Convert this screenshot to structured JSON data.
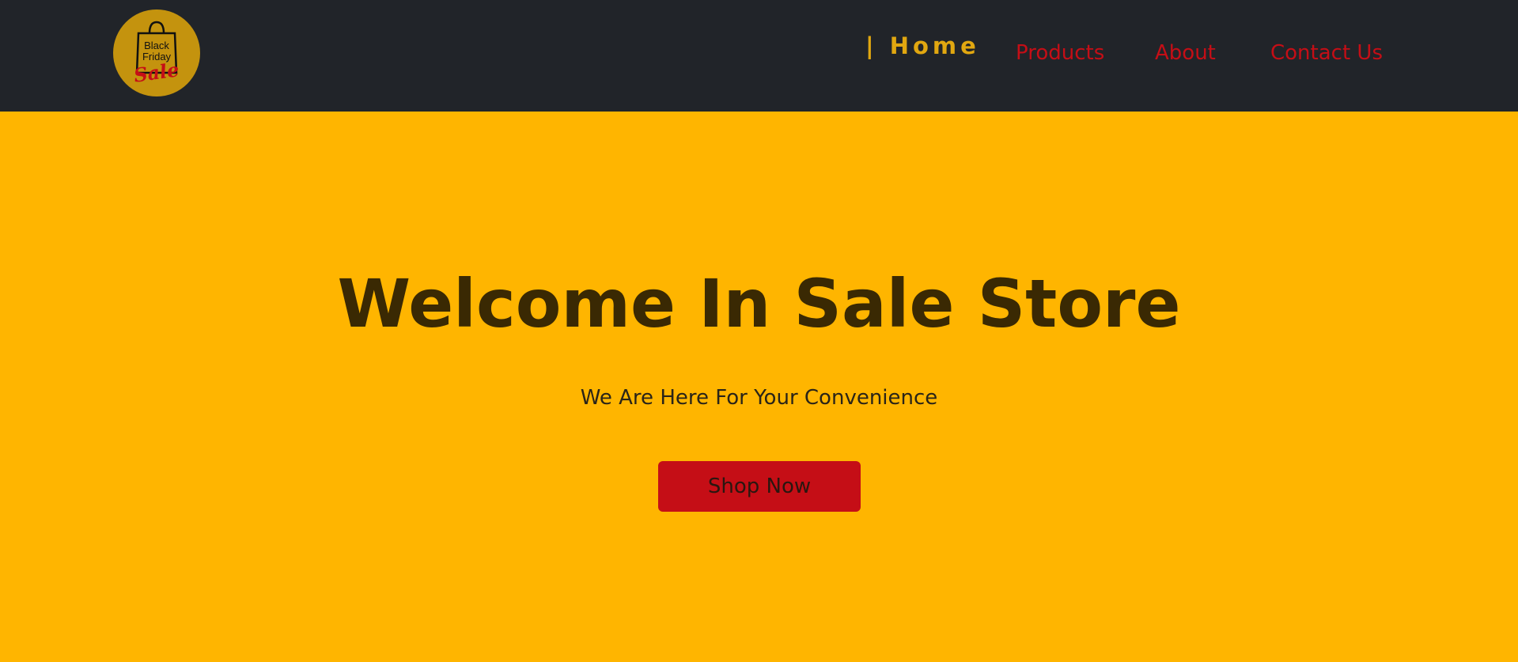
{
  "colors": {
    "navbar_bg": "#212429",
    "hero_bg": "#FFB500",
    "active_nav": "#E1A710",
    "nav_link": "#C50E16",
    "title_text": "#3A2903",
    "button_bg": "#C50E16",
    "logo_bg": "#C4930E"
  },
  "logo": {
    "icon": "shopping-bag-icon",
    "line1": "Black",
    "line2": "Friday",
    "line3": "Sale"
  },
  "nav": {
    "home": "| Home",
    "products": "Products",
    "about": "About",
    "contact": "Contact Us"
  },
  "hero": {
    "title": "Welcome In Sale Store",
    "subtitle": "We Are Here For Your Convenience",
    "button": "Shop Now"
  }
}
